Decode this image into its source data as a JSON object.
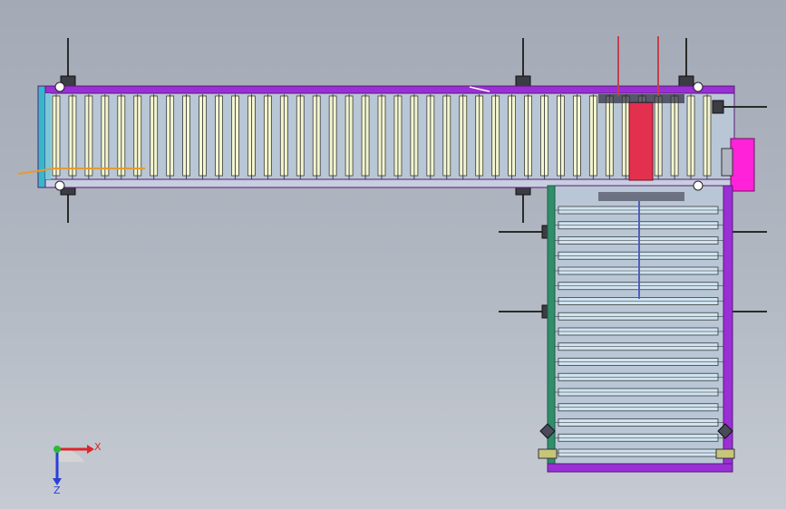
{
  "view": {
    "background_top": "#a3aab6",
    "background_bottom": "#c6cbd3"
  },
  "colors": {
    "frame": "#9b2fd6",
    "frame_dark": "#5a1a7a",
    "roller_top": "#f2f5cf",
    "roller_side": "#cfe3ef",
    "roller_outline": "#3b3b3b",
    "drive_motor": "#ff22d8",
    "transfer_unit": "#e3304f",
    "rail_green": "#2f8f6a",
    "guide_orange": "#e59b2f",
    "cyan_edge": "#35b9c8"
  },
  "model": {
    "main_conveyor": {
      "roller_count": 41
    },
    "side_conveyor": {
      "roller_count": 17
    }
  },
  "triad": {
    "x_label": "X",
    "z_label": "Z",
    "x_color": "#e0242a",
    "y_color": "#2bb93b",
    "z_color": "#2a3fd8"
  }
}
